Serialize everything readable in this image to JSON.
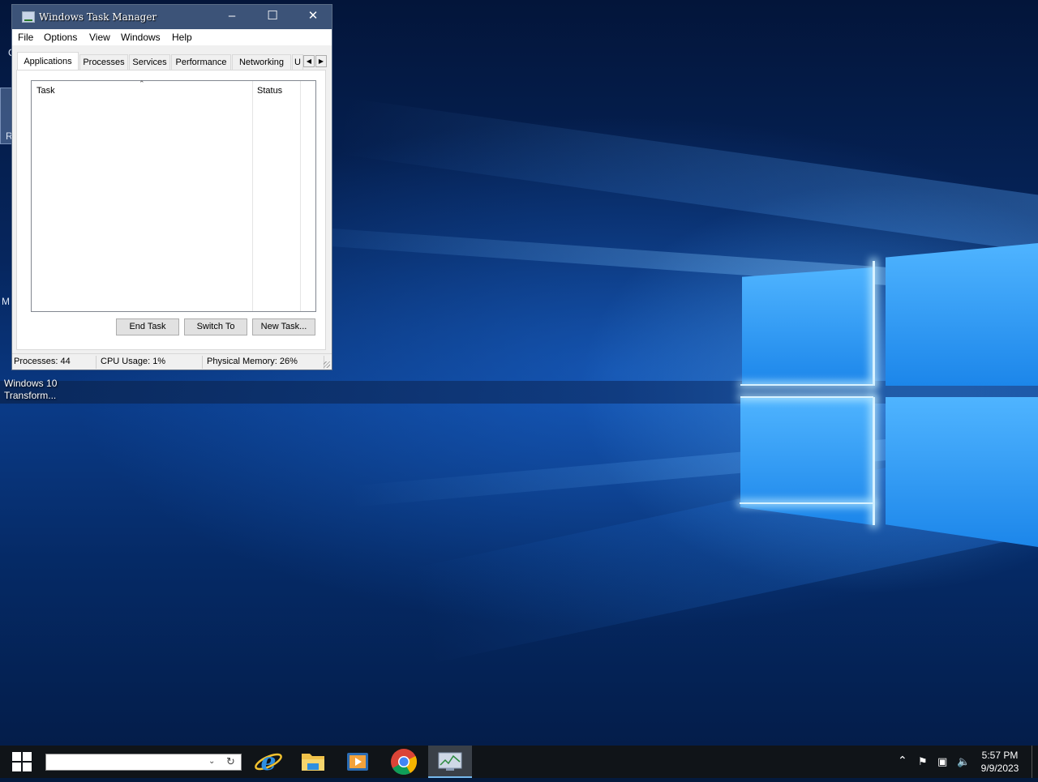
{
  "desktop": {
    "icon_label": "Windows 10 Transform...",
    "left_fragments": [
      "C",
      "R",
      "M"
    ]
  },
  "task_manager": {
    "title": "Windows Task Manager",
    "menu": [
      "File",
      "Options",
      "View",
      "Windows",
      "Help"
    ],
    "tabs": [
      "Applications",
      "Processes",
      "Services",
      "Performance",
      "Networking",
      "U"
    ],
    "active_tab": "Applications",
    "columns": {
      "task": "Task",
      "status": "Status"
    },
    "buttons": {
      "end_task": "End Task",
      "switch_to": "Switch To",
      "new_task": "New Task..."
    },
    "status": {
      "processes": "Processes: 44",
      "cpu": "CPU Usage: 1%",
      "memory": "Physical Memory: 26%"
    },
    "title_icons": {
      "minimize": "minimize-icon",
      "maximize": "maximize-icon",
      "close": "close-icon"
    }
  },
  "taskbar": {
    "search_value": "",
    "apps": [
      "internet-explorer-icon",
      "file-explorer-icon",
      "media-player-icon",
      "chrome-icon",
      "task-manager-icon"
    ],
    "time": "5:57 PM",
    "date": "9/9/2023"
  },
  "colors": {
    "titlebar": "#3c5378",
    "taskbar": "#101418",
    "accent": "#76b9ed"
  }
}
